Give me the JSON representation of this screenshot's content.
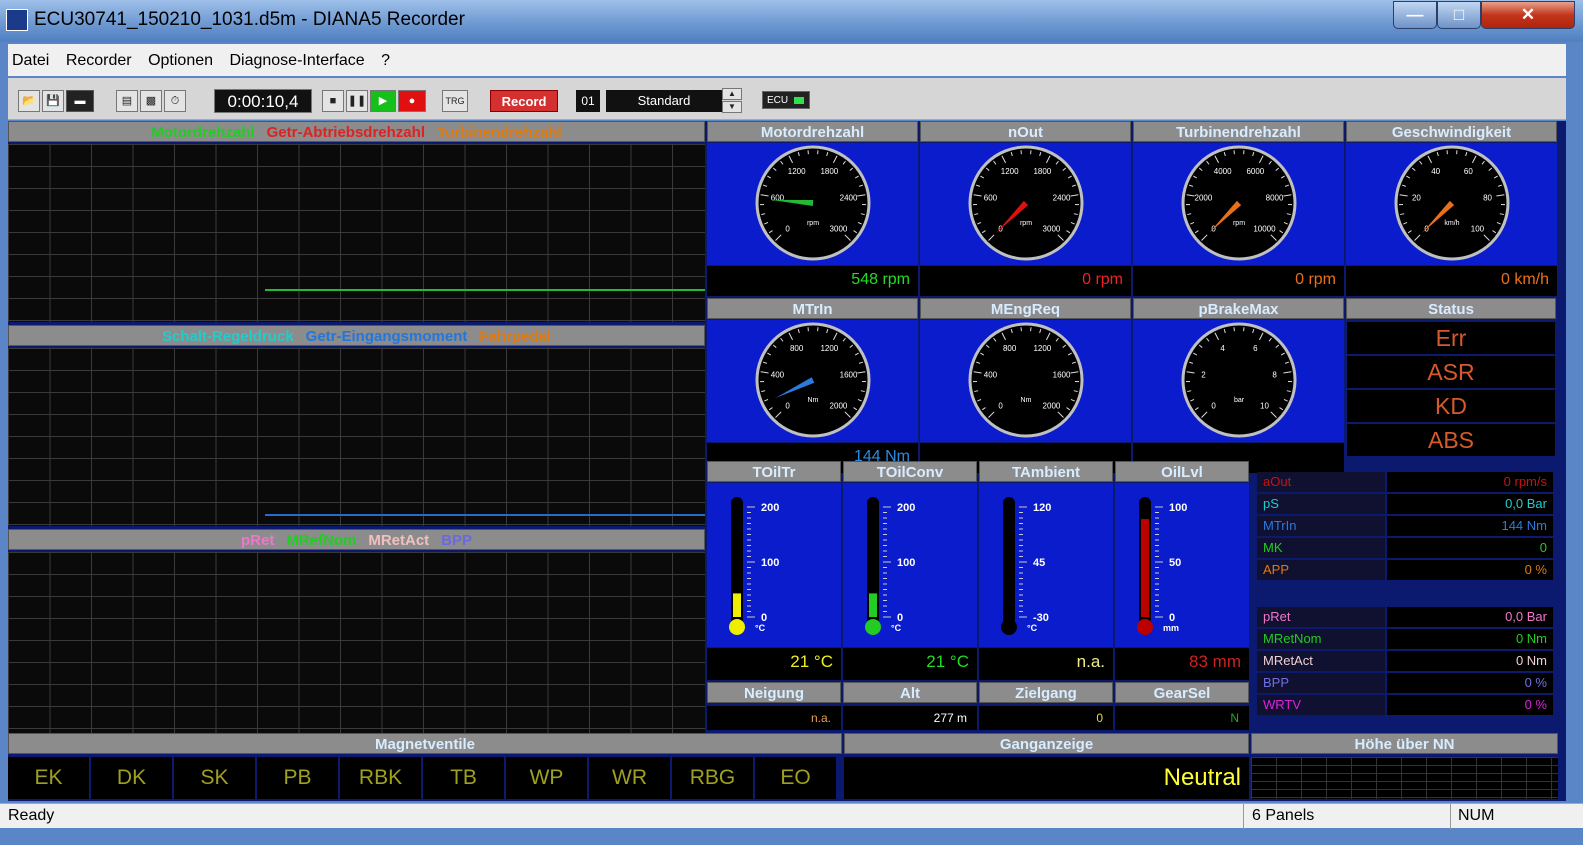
{
  "title": "ECU30741_150210_1031.d5m - DIANA5 Recorder",
  "menu": [
    "Datei",
    "Recorder",
    "Optionen",
    "Diagnose-Interface",
    "?"
  ],
  "toolbar": {
    "time": "0:00:10,4",
    "trg": "TRG",
    "record": "Record",
    "slot": "01",
    "preset": "Standard",
    "ecu": "ECU"
  },
  "graphs": [
    {
      "legend": [
        {
          "label": "Motordrehzahl",
          "color": "#22cc22"
        },
        {
          "label": "Getr-Abtriebsdrehzahl",
          "color": "#dd2222"
        },
        {
          "label": "Turbinendrehzahl",
          "color": "#e07a10"
        }
      ]
    },
    {
      "legend": [
        {
          "label": "Schalt-Regeldruck",
          "color": "#22cccc"
        },
        {
          "label": "Getr-Eingangsmoment",
          "color": "#2277dd"
        },
        {
          "label": "Fahrpedal",
          "color": "#e07a10"
        }
      ]
    },
    {
      "legend": [
        {
          "label": "pRet",
          "color": "#ee77cc"
        },
        {
          "label": "MRefNom",
          "color": "#22cc22"
        },
        {
          "label": "MRetAct",
          "color": "#f0c0c0"
        },
        {
          "label": "BPP",
          "color": "#6a6ae0"
        }
      ]
    }
  ],
  "gauges": [
    {
      "title": "Motordrehzahl",
      "ticks": [
        "0",
        "600",
        "1200",
        "1800",
        "2400",
        "3000"
      ],
      "unit": "rpm",
      "value": 548,
      "max": 3000,
      "needle": "#22bb33",
      "readout": "548 rpm",
      "readcolor": "#22dd22"
    },
    {
      "title": "nOut",
      "ticks": [
        "0",
        "600",
        "1200",
        "1800",
        "2400",
        "3000"
      ],
      "unit": "rpm",
      "value": 0,
      "max": 3000,
      "needle": "#dd1111",
      "readout": "0 rpm",
      "readcolor": "#ee2222"
    },
    {
      "title": "Turbinendrehzahl",
      "ticks": [
        "0",
        "2000",
        "4000",
        "6000",
        "8000",
        "10000"
      ],
      "unit": "rpm",
      "value": 0,
      "max": 10000,
      "needle": "#e8701a",
      "readout": "0 rpm",
      "readcolor": "#e8701a"
    },
    {
      "title": "Geschwindigkeit",
      "ticks": [
        "0",
        "20",
        "40",
        "60",
        "80",
        "100"
      ],
      "unit": "km/h",
      "value": 0,
      "max": 100,
      "needle": "#e8701a",
      "readout": "0 km/h",
      "readcolor": "#e8701a"
    },
    {
      "title": "MTrIn",
      "ticks": [
        "0",
        "400",
        "800",
        "1200",
        "1600",
        "2000"
      ],
      "unit": "Nm",
      "value": 144,
      "max": 2000,
      "needle": "#2a7ae0",
      "readout": "144 Nm",
      "readcolor": "#2a8ae0"
    },
    {
      "title": "MEngReq",
      "ticks": [
        "0",
        "400",
        "800",
        "1200",
        "1600",
        "2000"
      ],
      "unit": "Nm",
      "value": null,
      "max": 2000,
      "needle": "",
      "readout": "",
      "readcolor": "#fff"
    },
    {
      "title": "pBrakeMax",
      "ticks": [
        "0",
        "2",
        "4",
        "6",
        "8",
        "10"
      ],
      "unit": "bar",
      "value": null,
      "max": 10,
      "needle": "",
      "readout": "",
      "readcolor": "#fff"
    }
  ],
  "status": {
    "title": "Status",
    "items": [
      "Err",
      "ASR",
      "KD",
      "ABS"
    ]
  },
  "thermos": [
    {
      "title": "TOilTr",
      "ticks": [
        "200",
        "100",
        "0"
      ],
      "unit": "°C",
      "fill": 0.2,
      "color": "#eeee00",
      "readout": "21 °C",
      "readcolor": "#eeee22"
    },
    {
      "title": "TOilConv",
      "ticks": [
        "200",
        "100",
        "0"
      ],
      "unit": "°C",
      "fill": 0.2,
      "color": "#22cc22",
      "readout": "21 °C",
      "readcolor": "#22dd22"
    },
    {
      "title": "TAmbient",
      "ticks": [
        "120",
        "45",
        "-30"
      ],
      "unit": "°C",
      "fill": 0,
      "color": "#000000",
      "readout": "n.a.",
      "readcolor": "#eeee88"
    },
    {
      "title": "OilLvl",
      "ticks": [
        "100",
        "50",
        "0"
      ],
      "unit": "mm",
      "fill": 0.83,
      "color": "#bb0000",
      "readout": "83 mm",
      "readcolor": "#cc2222"
    }
  ],
  "smallpanels": [
    {
      "title": "Neigung",
      "value": "n.a.",
      "color": "#e8a050"
    },
    {
      "title": "Alt",
      "value": "277 m",
      "color": "#ffffff"
    },
    {
      "title": "Zielgang",
      "value": "0",
      "color": "#dddd44"
    },
    {
      "title": "GearSel",
      "value": "N",
      "color": "#22aa22"
    }
  ],
  "values1": [
    {
      "name": "aOut",
      "value": "0 rpm/s",
      "color": "#cc1111"
    },
    {
      "name": "pS",
      "value": "0,0 Bar",
      "color": "#22cccc"
    },
    {
      "name": "MTrIn",
      "value": "144 Nm",
      "color": "#2a7ae0"
    },
    {
      "name": "MK",
      "value": "0",
      "color": "#22cc22"
    },
    {
      "name": "APP",
      "value": "0 %",
      "color": "#e07a10"
    }
  ],
  "values2": [
    {
      "name": "pRet",
      "value": "0,0 Bar",
      "color": "#ee77cc"
    },
    {
      "name": "MRetNom",
      "value": "0 Nm",
      "color": "#22cc22"
    },
    {
      "name": "MRetAct",
      "value": "0 Nm",
      "color": "#f0d0d0"
    },
    {
      "name": "BPP",
      "value": "0 %",
      "color": "#7070e0"
    },
    {
      "name": "WRTV",
      "value": "0 %",
      "color": "#dd22dd"
    }
  ],
  "bottom": {
    "magnet_title": "Magnetventile",
    "magnet": [
      "EK",
      "DK",
      "SK",
      "PB",
      "RBK",
      "TB",
      "WP",
      "WR",
      "RBG",
      "EO"
    ],
    "gang_title": "Ganganzeige",
    "gang": "Neutral",
    "hoehe_title": "Höhe über NN"
  },
  "statusbar": {
    "text": "Ready",
    "panels": "6 Panels",
    "num": "NUM"
  }
}
